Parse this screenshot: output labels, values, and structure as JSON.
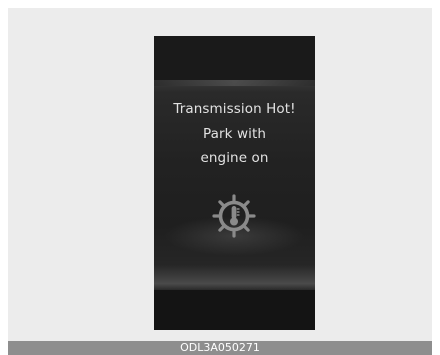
{
  "warning": {
    "line1": "Transmission Hot!",
    "line2": "Park with",
    "line3": "engine on",
    "icon": "transmission-temperature-gear-icon"
  },
  "figure": {
    "code": "ODL3A050271"
  },
  "colors": {
    "display_bg": "#161616",
    "text": "#e2e2e2",
    "icon": "#8a8a8a",
    "footer_bar": "#8e8e8e"
  }
}
